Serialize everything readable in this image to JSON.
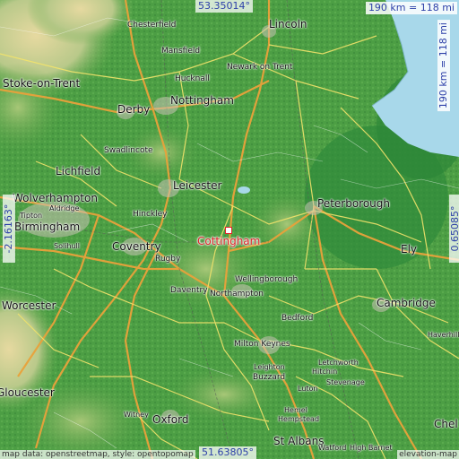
{
  "map": {
    "focus_place": "Cottingham",
    "coordinates": {
      "top_lat": "53.35014°",
      "bottom_lat": "51.63805°",
      "left_lon": "-2.16163°",
      "right_lon": "0.65085°"
    },
    "scale_horizontal": "190 km = 118 mi",
    "scale_vertical": "190 km = 118 mi",
    "attribution_left": "map data: openstreetmap, style: opentopomap",
    "attribution_right": "elevation-map",
    "colors": {
      "water": "#a8d8ea",
      "land_low": "#4fa146",
      "land_high": "#d7c98c",
      "focus": "#e0242c",
      "coords": "#2c3fa8"
    },
    "places": [
      {
        "name": "Chesterfield",
        "size": "sm"
      },
      {
        "name": "Lincoln",
        "size": "big"
      },
      {
        "name": "Mansfield",
        "size": "sm"
      },
      {
        "name": "Newark on Trent",
        "size": "sm"
      },
      {
        "name": "Stoke-on-Trent",
        "size": "big"
      },
      {
        "name": "Hucknall",
        "size": "sm"
      },
      {
        "name": "Nottingham",
        "size": "big"
      },
      {
        "name": "Derby",
        "size": "big"
      },
      {
        "name": "Swadlincote",
        "size": "sm"
      },
      {
        "name": "Lichfield",
        "size": "big"
      },
      {
        "name": "Leicester",
        "size": "big"
      },
      {
        "name": "Wolverhampton",
        "size": "big"
      },
      {
        "name": "Aldridge",
        "size": "xs"
      },
      {
        "name": "Tipton",
        "size": "xs"
      },
      {
        "name": "Peterborough",
        "size": "big"
      },
      {
        "name": "Birmingham",
        "size": "big"
      },
      {
        "name": "Hinckley",
        "size": "sm"
      },
      {
        "name": "Solihull",
        "size": "xs"
      },
      {
        "name": "Coventry",
        "size": "big"
      },
      {
        "name": "Ely",
        "size": "big"
      },
      {
        "name": "Rugby",
        "size": "sm"
      },
      {
        "name": "Wellingborough",
        "size": "sm"
      },
      {
        "name": "Daventry",
        "size": "sm"
      },
      {
        "name": "Northampton",
        "size": "sm"
      },
      {
        "name": "Worcester",
        "size": "big"
      },
      {
        "name": "Cambridge",
        "size": "big"
      },
      {
        "name": "Bedford",
        "size": "sm"
      },
      {
        "name": "Haverhill",
        "size": "xs"
      },
      {
        "name": "Milton Keynes",
        "size": "sm"
      },
      {
        "name": "Letchworth",
        "size": "xs"
      },
      {
        "name": "Leighton",
        "size": "xs"
      },
      {
        "name": "Buzzard",
        "size": "sm"
      },
      {
        "name": "Hitchin",
        "size": "xs"
      },
      {
        "name": "Stevenage",
        "size": "xs"
      },
      {
        "name": "Luton",
        "size": "xs"
      },
      {
        "name": "Hemel",
        "size": "xs"
      },
      {
        "name": "Hempstead",
        "size": "xs"
      },
      {
        "name": "Gloucester",
        "size": "big"
      },
      {
        "name": "Witney",
        "size": "xs"
      },
      {
        "name": "Oxford",
        "size": "big"
      },
      {
        "name": "St Albans",
        "size": "big"
      },
      {
        "name": "Watford",
        "size": "xs"
      },
      {
        "name": "High Barnet",
        "size": "xs"
      },
      {
        "name": "Chel",
        "size": "big"
      }
    ]
  }
}
